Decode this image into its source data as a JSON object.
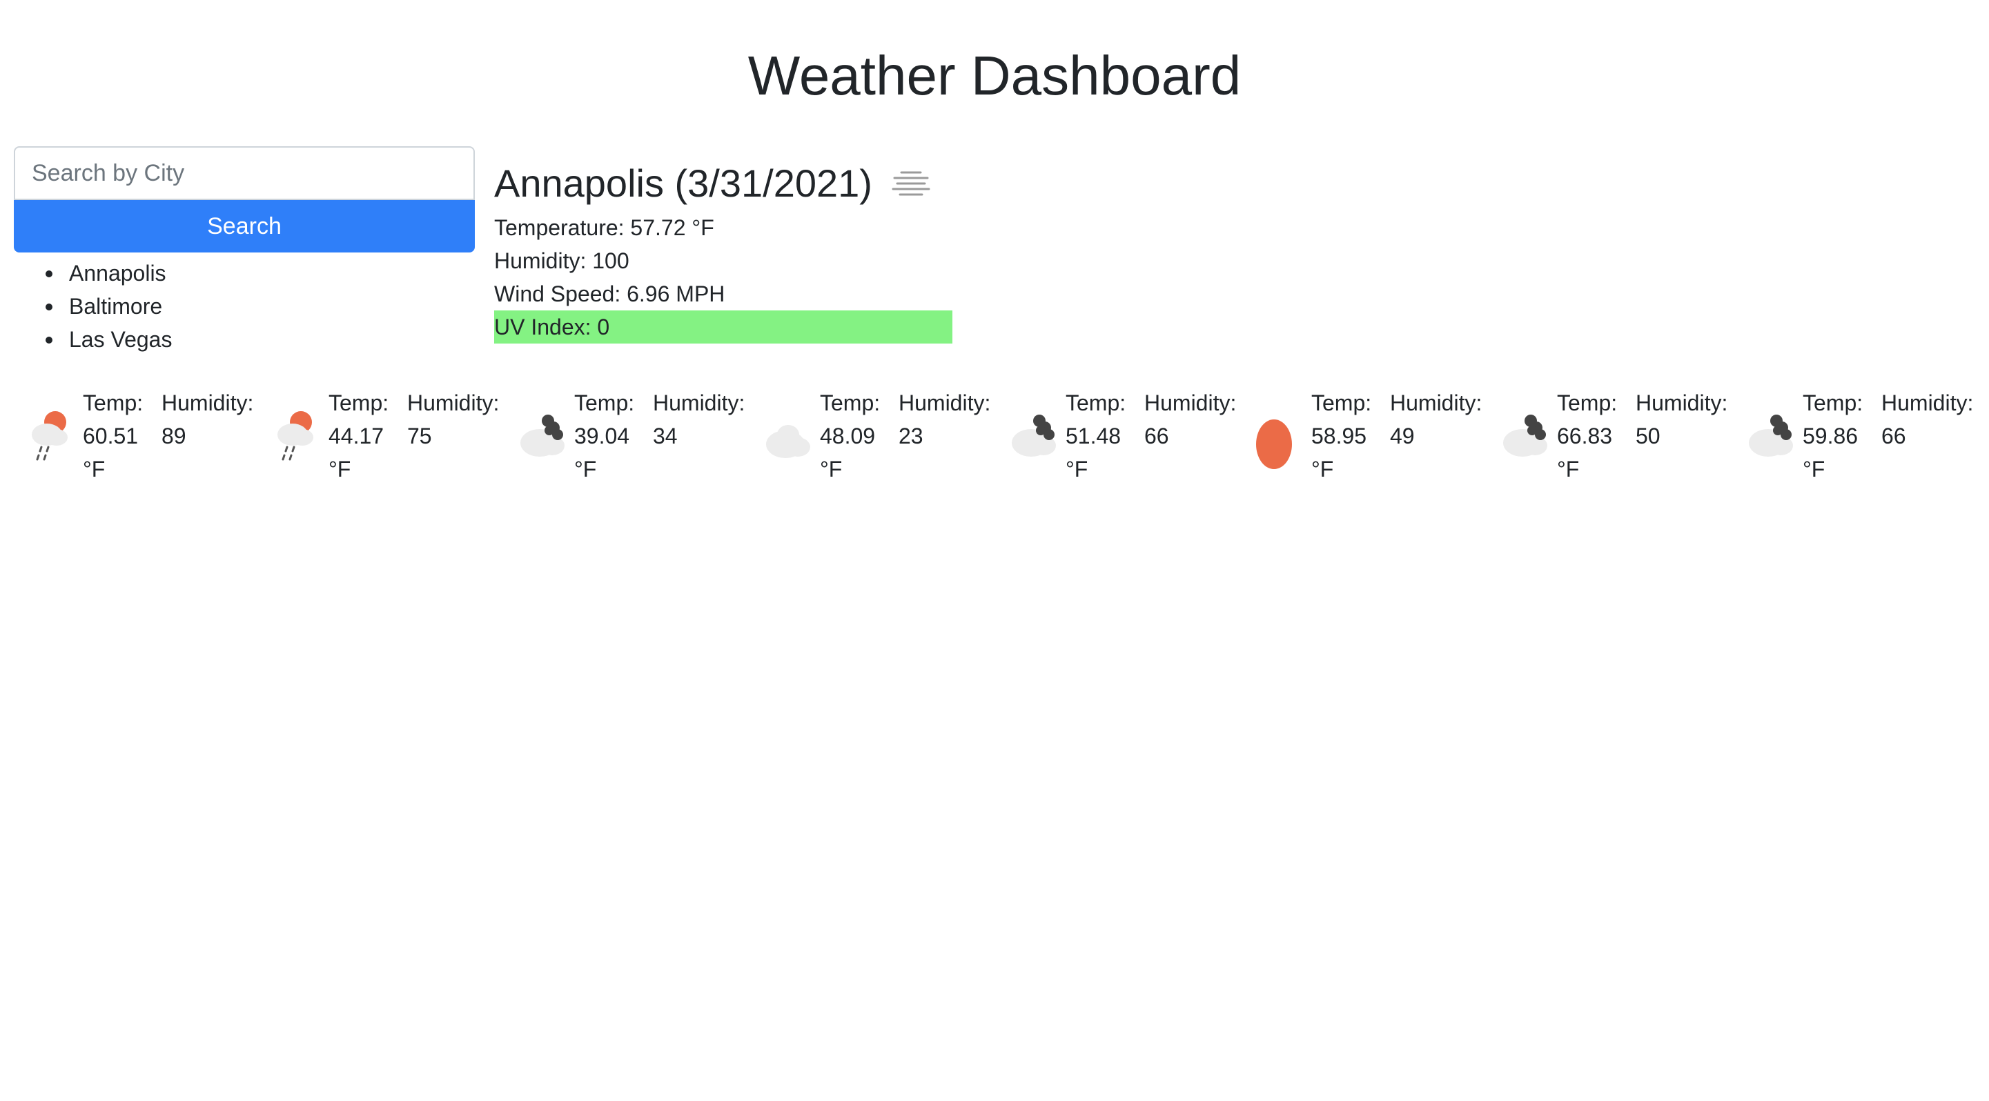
{
  "header": {
    "title": "Weather Dashboard"
  },
  "search": {
    "placeholder": "Search by City",
    "button_label": "Search"
  },
  "history": [
    "Annapolis",
    "Baltimore",
    "Las Vegas"
  ],
  "current": {
    "city_date": "Annapolis (3/31/2021)",
    "icon": "mist-icon",
    "temperature": "Temperature: 57.72 °F",
    "humidity": "Humidity: 100",
    "wind": "Wind Speed: 6.96 MPH",
    "uv": "UV Index: 0",
    "uv_color": "#84f283"
  },
  "forecast_labels": {
    "temp": "Temp:",
    "humidity": "Humidity:",
    "unit": "°F"
  },
  "forecast": [
    {
      "icon": "rain-sun-icon",
      "temp": "60.51",
      "humidity": "89"
    },
    {
      "icon": "rain-sun-icon",
      "temp": "44.17",
      "humidity": "75"
    },
    {
      "icon": "broken-clouds-icon",
      "temp": "39.04",
      "humidity": "34"
    },
    {
      "icon": "cloud-icon",
      "temp": "48.09",
      "humidity": "23"
    },
    {
      "icon": "broken-clouds-icon",
      "temp": "51.48",
      "humidity": "66"
    },
    {
      "icon": "clear-sun-icon",
      "temp": "58.95",
      "humidity": "49"
    },
    {
      "icon": "broken-clouds-icon",
      "temp": "66.83",
      "humidity": "50"
    },
    {
      "icon": "broken-clouds-icon",
      "temp": "59.86",
      "humidity": "66"
    }
  ],
  "colors": {
    "accent": "#2f7ff9",
    "uv_low": "#84f283",
    "sun": "#eb6b47"
  }
}
